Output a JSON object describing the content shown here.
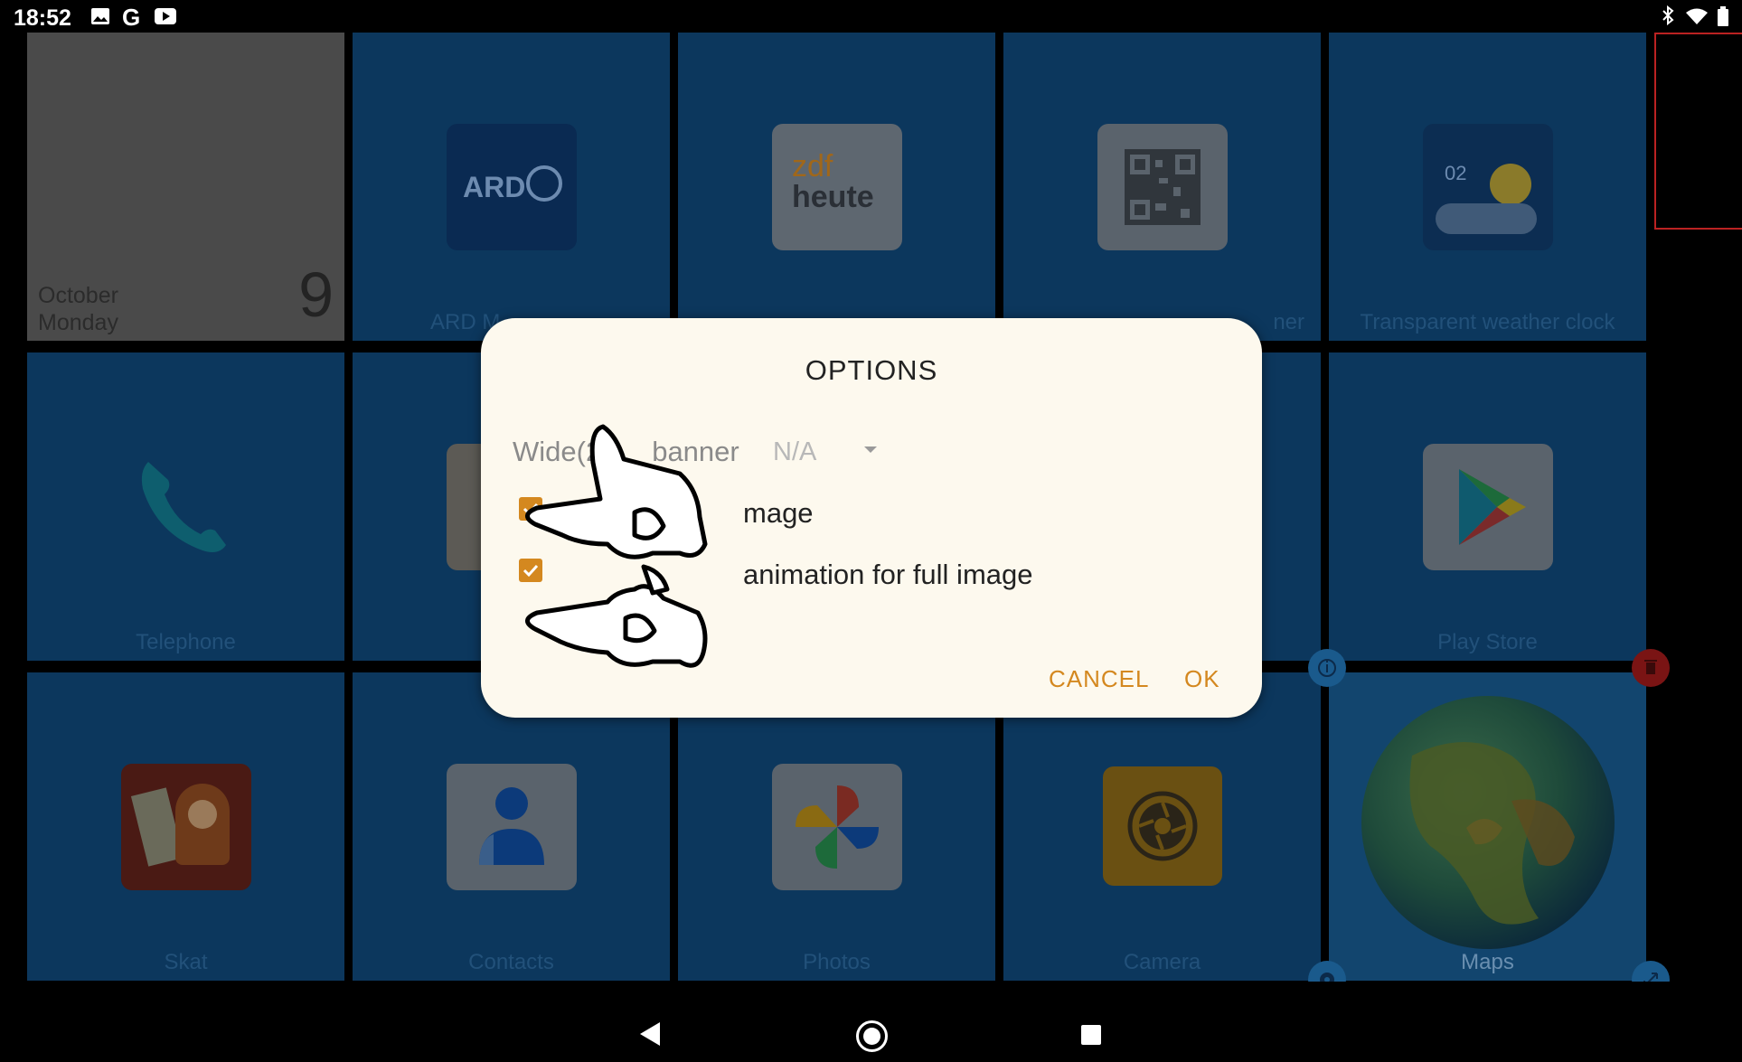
{
  "status_bar": {
    "time": "18:52",
    "left_icons": [
      "image-icon",
      "google-icon",
      "youtube-icon"
    ],
    "right_icons": [
      "bluetooth-icon",
      "wifi-icon",
      "battery-icon"
    ]
  },
  "calendar_widget": {
    "month": "October",
    "weekday": "Monday",
    "day": "9"
  },
  "tiles": [
    {
      "id": "ard",
      "label": "ARD M",
      "icon_text": "ARD"
    },
    {
      "id": "zdf",
      "label": "",
      "icon_text_top": "zdf",
      "icon_text_bottom": "heute"
    },
    {
      "id": "qr",
      "label": "ner",
      "icon": "qr-code-icon"
    },
    {
      "id": "weather",
      "label": "Transparent weather clock",
      "icon_text": "02"
    },
    {
      "id": "telephone",
      "label": "Telephone",
      "icon": "phone-icon"
    },
    {
      "id": "playstore",
      "label": "Play Store",
      "icon": "play-store-icon"
    },
    {
      "id": "skat",
      "label": "Skat",
      "icon": "card-game-icon"
    },
    {
      "id": "contacts",
      "label": "Contacts",
      "icon": "contact-icon"
    },
    {
      "id": "photos",
      "label": "Photos",
      "icon": "pinwheel-icon"
    },
    {
      "id": "camera",
      "label": "Camera",
      "icon": "aperture-icon"
    },
    {
      "id": "maps",
      "label": "Maps",
      "icon": "globe-icon"
    }
  ],
  "dialog": {
    "title": "OPTIONS",
    "row1_label": "Wide(2",
    "row1_label_tail": "banner",
    "row1_value": "N/A",
    "option1_text": "mage",
    "option2_text": "animation for full image",
    "option1_checked": true,
    "option2_checked": true,
    "cancel": "CANCEL",
    "ok": "OK"
  },
  "colors": {
    "accent": "#d4881f",
    "tile_bg": "#0c375d",
    "dialog_bg": "#fdf9ee"
  }
}
